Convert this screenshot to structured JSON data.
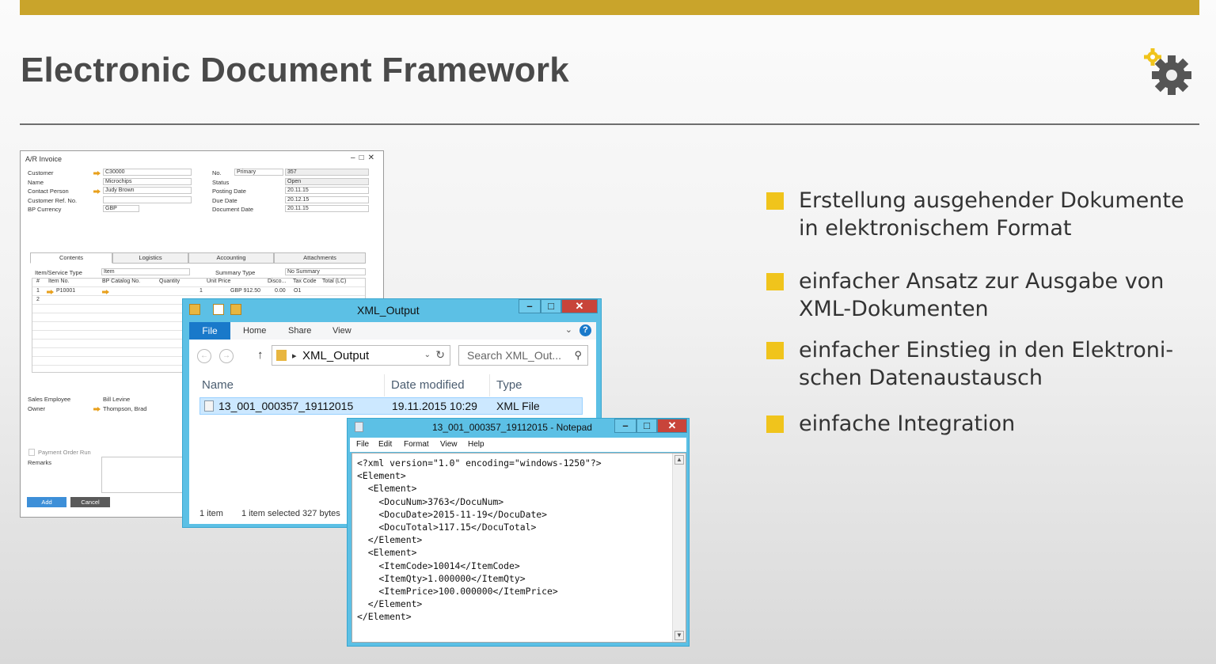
{
  "slide": {
    "title": "Electronic Document Framework",
    "accent_color": "#c9a42b",
    "bullet_color": "#f0c41c",
    "logo_icon": "gear-icon",
    "bullets": [
      {
        "line1": "Erstellung ausgehender Dokumente",
        "line2": "in elektronischem Format"
      },
      {
        "line1": "einfacher Ansatz zur Ausgabe von",
        "line2": "XML-Dokumenten"
      },
      {
        "line1": "einfacher Einstieg in den Elektroni-",
        "line2": "schen Datenaustausch"
      },
      {
        "line1": "einfache Integration",
        "line2": ""
      }
    ]
  },
  "invoice": {
    "title": "A/R Invoice",
    "fields": {
      "customer_label": "Customer",
      "customer_value": "C30000",
      "name_label": "Name",
      "name_value": "Microchips",
      "contact_label": "Contact Person",
      "contact_value": "Judy Brown",
      "ref_label": "Customer Ref. No.",
      "ref_value": "",
      "currency_label": "BP Currency",
      "currency_value": "GBP",
      "no_label": "No.",
      "no_series": "Primary",
      "no_value": "357",
      "status_label": "Status",
      "status_value": "Open",
      "posting_label": "Posting Date",
      "posting_value": "20.11.15",
      "due_label": "Due Date",
      "due_value": "20.12.15",
      "docdate_label": "Document Date",
      "docdate_value": "20.11.15"
    },
    "tabs": [
      "Contents",
      "Logistics",
      "Accounting",
      "Attachments"
    ],
    "item_type_label": "Item/Service Type",
    "item_type_value": "Item",
    "summary_label": "Summary Type",
    "summary_value": "No Summary",
    "grid_headers": [
      "#",
      "Item No.",
      "BP Catalog No.",
      "Quantity",
      "Unit Price",
      "Disco...",
      "Tax Code",
      "Total (LC)"
    ],
    "row1": {
      "num": "1",
      "item": "P10001",
      "qty": "1",
      "price": "GBP 912.50",
      "disc": "0.00",
      "tax": "O1"
    },
    "row2_num": "2",
    "sales_label": "Sales Employee",
    "sales_value": "Bill Levine",
    "owner_label": "Owner",
    "owner_value": "Thompson, Brad",
    "payment_label": "Payment Order Run",
    "remarks_label": "Remarks",
    "add_label": "Add",
    "cancel_label": "Cancel"
  },
  "explorer": {
    "title": "XML_Output",
    "ribbon_tabs": [
      "File",
      "Home",
      "Share",
      "View"
    ],
    "address": "XML_Output",
    "search_placeholder": "Search XML_Out...",
    "columns": [
      "Name",
      "Date modified",
      "Type"
    ],
    "file": {
      "name": "13_001_000357_19112015",
      "date": "19.11.2015 10:29",
      "type": "XML File"
    },
    "status_count": "1 item",
    "status_selected": "1 item selected  327 bytes"
  },
  "notepad": {
    "title": "13_001_000357_19112015 - Notepad",
    "menu": [
      "File",
      "Edit",
      "Format",
      "View",
      "Help"
    ],
    "lines": [
      "<?xml version=\"1.0\" encoding=\"windows-1250\"?>",
      "<Element>",
      "  <Element>",
      "    <DocuNum>3763</DocuNum>",
      "    <DocuDate>2015-11-19</DocuDate>",
      "    <DocuTotal>117.15</DocuTotal>",
      "  </Element>",
      "  <Element>",
      "    <ItemCode>10014</ItemCode>",
      "    <ItemQty>1.000000</ItemQty>",
      "    <ItemPrice>100.000000</ItemPrice>",
      "  </Element>",
      "</Element>"
    ]
  }
}
